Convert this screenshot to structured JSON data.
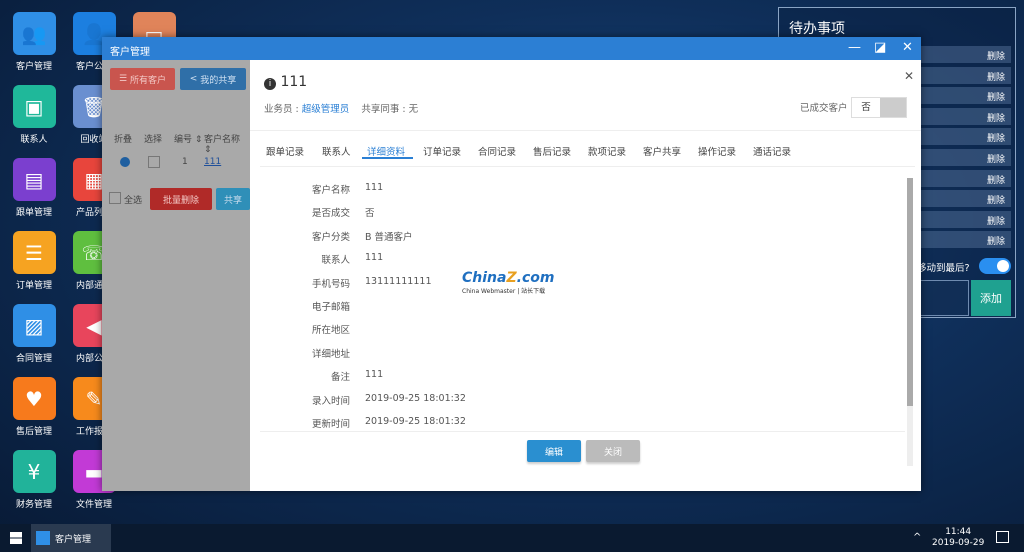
{
  "desktop": {
    "icons": [
      {
        "label": "客户管理",
        "color": "#2f8fe6",
        "glyph": "👥"
      },
      {
        "label": "客户公海",
        "color": "#1c7fe0",
        "glyph": "👤"
      },
      {
        "label": "联系人",
        "color": "#1fb89a",
        "glyph": "▣"
      },
      {
        "label": "回收站",
        "color": "#6a8fd0",
        "glyph": "🗑"
      },
      {
        "label": "跟单管理",
        "color": "#7b3fcf",
        "glyph": "▤"
      },
      {
        "label": "产品列表",
        "color": "#e8453c",
        "glyph": "▦"
      },
      {
        "label": "订单管理",
        "color": "#f6a321",
        "glyph": "☰"
      },
      {
        "label": "内部通讯",
        "color": "#5fbf3f",
        "glyph": "☏"
      },
      {
        "label": "合同管理",
        "color": "#2f8fe6",
        "glyph": "▨"
      },
      {
        "label": "内部公告",
        "color": "#e8455c",
        "glyph": "◀"
      },
      {
        "label": "售后管理",
        "color": "#f77a1c",
        "glyph": "♥"
      },
      {
        "label": "工作报告",
        "color": "#f78a1c",
        "glyph": "✎"
      },
      {
        "label": "财务管理",
        "color": "#21b39a",
        "glyph": "¥"
      },
      {
        "label": "文件管理",
        "color": "#c23ad6",
        "glyph": "▬"
      }
    ]
  },
  "todo": {
    "title": "待办事项",
    "delete_label": "删除",
    "rows": 10,
    "move_label": "移动到最后?",
    "toggle_on": true,
    "add_label": "添加"
  },
  "window": {
    "title": "客户管理",
    "minimize": "—",
    "maximize": "◪",
    "close": "✕",
    "toolbar": {
      "all": "所有客户",
      "share": "我的共享"
    },
    "table": {
      "headers": [
        "折叠",
        "选择",
        "编号 ⇕",
        "客户名称 ⇕"
      ],
      "row": {
        "id": "1",
        "name": "111"
      }
    },
    "select_all": "全选",
    "batch_delete": "批量删除",
    "share_btn": "共享"
  },
  "modal": {
    "title": "111",
    "salesman_label": "业务员 : ",
    "salesman": "超级管理员",
    "share_label": "共享同事 : 无",
    "deal_label": "已成交客户",
    "deal_value": "否",
    "close": "✕",
    "tabs": [
      "跟单记录",
      "联系人",
      "详细资料",
      "订单记录",
      "合同记录",
      "售后记录",
      "款项记录",
      "客户共享",
      "操作记录",
      "通话记录"
    ],
    "active_tab": 2,
    "fields": [
      {
        "label": "客户名称",
        "value": "111"
      },
      {
        "label": "是否成交",
        "value": "否"
      },
      {
        "label": "客户分类",
        "value": "B 普通客户"
      },
      {
        "label": "联系人",
        "value": "111"
      },
      {
        "label": "手机号码",
        "value": "13111111111"
      },
      {
        "label": "电子邮箱",
        "value": ""
      },
      {
        "label": "所在地区",
        "value": ""
      },
      {
        "label": "详细地址",
        "value": ""
      },
      {
        "label": "备注",
        "value": "111"
      },
      {
        "label": "录入时间",
        "value": "2019-09-25 18:01:32"
      },
      {
        "label": "更新时间",
        "value": "2019-09-25 18:01:32"
      }
    ],
    "edit": "编辑",
    "close_btn": "关闭"
  },
  "watermark": {
    "main": "ChinaZ.com",
    "sub": "China Webmaster | 站长下载"
  },
  "taskbar": {
    "app": "客户管理",
    "time": "11:44",
    "date": "2019-09-29"
  }
}
